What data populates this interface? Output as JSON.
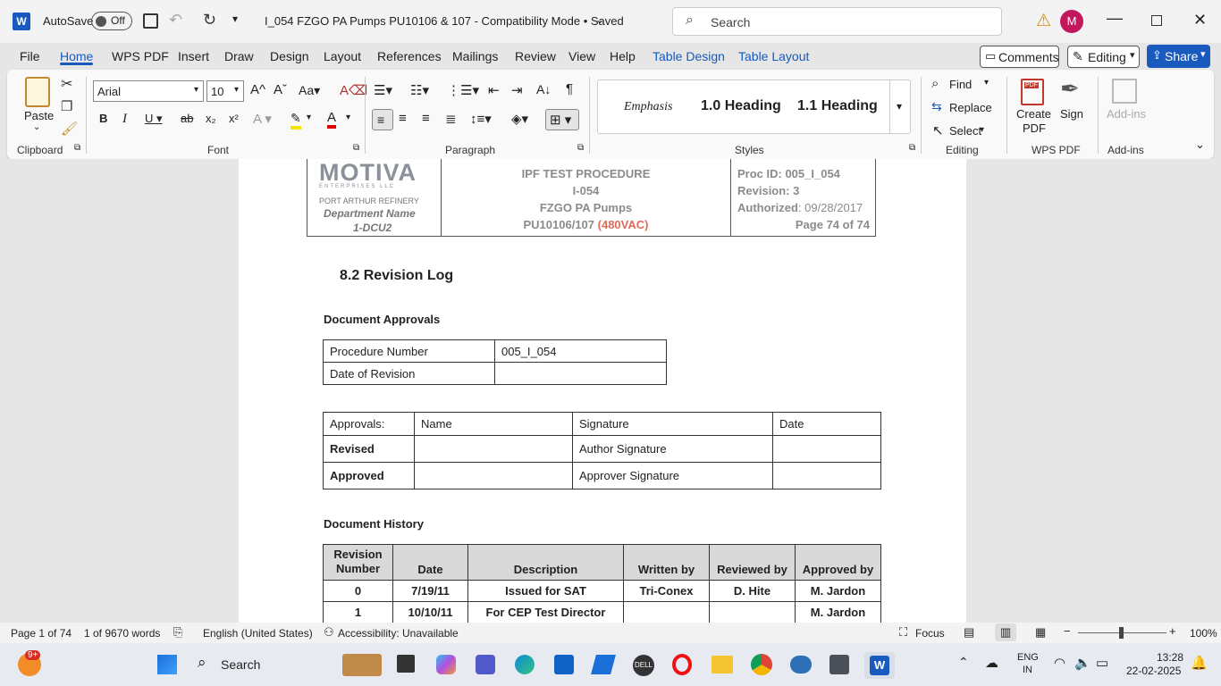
{
  "titlebar": {
    "autosave_label": "AutoSave",
    "autosave_state": "Off",
    "doc_title": "I_054 FZGO PA Pumps PU10106 & 107  -  Compatibility Mode • Saved",
    "search_placeholder": "Search",
    "avatar_initial": "M"
  },
  "menu": {
    "tabs": [
      "File",
      "Home",
      "WPS PDF",
      "Insert",
      "Draw",
      "Design",
      "Layout",
      "References",
      "Mailings",
      "Review",
      "View",
      "Help",
      "Table Design",
      "Table Layout"
    ],
    "comments": "Comments",
    "editing": "Editing",
    "share": "Share"
  },
  "ribbon": {
    "clipboard": {
      "paste": "Paste",
      "label": "Clipboard"
    },
    "font": {
      "family": "Arial",
      "size": "10",
      "label": "Font"
    },
    "paragraph": {
      "label": "Paragraph"
    },
    "styles": {
      "items": [
        "Emphasis",
        "1.0  Heading",
        "1.1  Heading"
      ],
      "label": "Styles"
    },
    "editing": {
      "find": "Find",
      "replace": "Replace",
      "select": "Select",
      "label": "Editing"
    },
    "wps": {
      "create": "Create",
      "pdf": "PDF",
      "sign": "Sign",
      "label": "WPS PDF"
    },
    "addins": {
      "item": "Add-ins",
      "label": "Add-ins"
    }
  },
  "doc": {
    "header": {
      "logo": "MOTIVA",
      "logo_sub": "ENTERPRISES LLC",
      "refinery": "PORT ARTHUR REFINERY",
      "dept": "Department Name",
      "unit": "1-DCU2",
      "proc_title1": "IPF TEST PROCEDURE",
      "proc_title2": "I-054",
      "proc_title3": "FZGO PA Pumps",
      "proc_title4": "PU10106/107",
      "proc_voltage": "(480VAC)",
      "proc_id": "Proc ID: 005_I_054",
      "revision": "Revision: 3",
      "authorized_label": "Authorized",
      "authorized_date": ": 09/28/2017",
      "page": "Page 74 of 74"
    },
    "section_title": "8.2  Revision Log",
    "approvals_heading": "Document Approvals",
    "proc_table": [
      [
        "Procedure Number",
        "005_I_054"
      ],
      [
        "Date of Revision",
        ""
      ]
    ],
    "approvals_table": {
      "headers": [
        "Approvals:",
        "Name",
        "Signature",
        "Date"
      ],
      "rows": [
        [
          "Revised",
          "",
          "Author Signature",
          ""
        ],
        [
          "Approved",
          "",
          "Approver Signature",
          ""
        ]
      ]
    },
    "history_heading": "Document History",
    "history_table": {
      "headers": [
        "Revision Number",
        "Date",
        "Description",
        "Written by",
        "Reviewed by",
        "Approved by"
      ],
      "rows": [
        [
          "0",
          "7/19/11",
          "Issued for SAT",
          "Tri-Conex",
          "D. Hite",
          "M. Jardon"
        ],
        [
          "1",
          "10/10/11",
          "For CEP Test Director",
          "",
          "",
          "M. Jardon"
        ]
      ]
    }
  },
  "status": {
    "page": "Page 1 of 74",
    "words": "1 of 9670 words",
    "language": "English (United States)",
    "accessibility": "Accessibility: Unavailable",
    "focus": "Focus",
    "zoom": "100%"
  },
  "taskbar": {
    "search": "Search",
    "badge": "9+",
    "lang1": "ENG",
    "lang2": "IN",
    "time": "13:28",
    "date": "22-02-2025"
  }
}
